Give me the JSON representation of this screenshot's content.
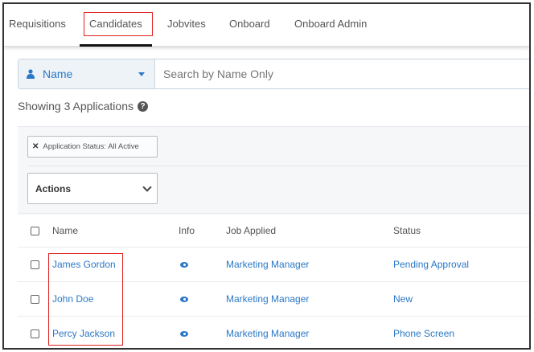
{
  "nav": {
    "tabs": [
      {
        "label": "Requisitions"
      },
      {
        "label": "Candidates",
        "active": true
      },
      {
        "label": "Jobvites"
      },
      {
        "label": "Onboard"
      },
      {
        "label": "Onboard Admin"
      }
    ]
  },
  "search": {
    "field": "Name",
    "placeholder": "Search by Name Only",
    "field_icon": "user-icon"
  },
  "summary": {
    "text": "Showing 3 Applications",
    "help_icon": "?"
  },
  "filters": [
    {
      "label": "Application Status: All Active",
      "remove_icon": "✕"
    }
  ],
  "actions": {
    "label": "Actions"
  },
  "table": {
    "headers": {
      "name": "Name",
      "info": "Info",
      "job": "Job Applied",
      "status": "Status"
    },
    "rows": [
      {
        "name": "James Gordon",
        "job": "Marketing Manager",
        "status": "Pending Approval"
      },
      {
        "name": "John Doe",
        "job": "Marketing Manager",
        "status": "New"
      },
      {
        "name": "Percy Jackson",
        "job": "Marketing Manager",
        "status": "Phone Screen"
      }
    ]
  },
  "colors": {
    "accent": "#2a78c6",
    "highlight": "#e02020"
  }
}
